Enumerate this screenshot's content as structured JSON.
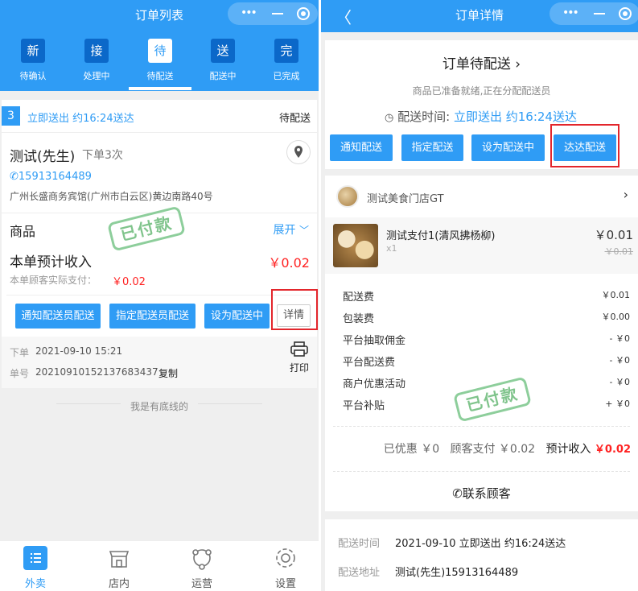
{
  "left": {
    "nav_title": "订单列表",
    "tabs": [
      {
        "icon": "新",
        "label": "待确认"
      },
      {
        "icon": "接",
        "label": "处理中"
      },
      {
        "icon": "待",
        "label": "待配送"
      },
      {
        "icon": "送",
        "label": "配送中"
      },
      {
        "icon": "完",
        "label": "已完成"
      }
    ],
    "order": {
      "index": "3",
      "delivery": "立即送出 约16:24送达",
      "status": "待配送",
      "customer": "测试(先生)",
      "order_count": "下单3次",
      "phone": "15913164489",
      "address": "广州长盛商务宾馆(广州市白云区)黄边南路40号",
      "goods_label": "商品",
      "expand_label": "展开",
      "income_label": "本单预计收入",
      "income_value": "￥0.02",
      "paid_label": "本单顾客实际支付：",
      "paid_value": "￥0.02",
      "stamp": "已付款",
      "buttons": [
        "通知配送员配送",
        "指定配送员配送",
        "设为配送中"
      ],
      "detail_button": "详情",
      "order_time_label": "下单",
      "order_time": "2021-09-10 15:21",
      "order_no_label": "单号",
      "order_no": "20210910152137683437",
      "copy_label": "复制",
      "print_label": "打印"
    },
    "bottom_line": "我是有底线的",
    "bottom_nav": [
      "外卖",
      "店内",
      "运营",
      "设置"
    ],
    "bottom_icons": [
      "list-icon",
      "store-icon",
      "operation-icon",
      "gear-icon"
    ]
  },
  "right": {
    "nav_title": "订单详情",
    "status_title": "订单待配送",
    "status_desc": "商品已准备就绪,正在分配配送员",
    "delivery_time_label": "配送时间:",
    "delivery_time_value": "立即送出 约16:24送达",
    "buttons": [
      "通知配送",
      "指定配送",
      "设为配送中",
      "达达配送"
    ],
    "store_name": "测试美食门店GT",
    "product": {
      "name": "测试支付1(清风拂杨柳)",
      "qty": "x1",
      "price": "￥0.01",
      "original_price": "￥0.01"
    },
    "fees": [
      {
        "label": "配送费",
        "value": "￥0.01"
      },
      {
        "label": "包装费",
        "value": "￥0.00"
      },
      {
        "label": "平台抽取佣金",
        "value": "- ￥0"
      },
      {
        "label": "平台配送费",
        "value": "- ￥0"
      },
      {
        "label": "商户优惠活动",
        "value": "- ￥0"
      },
      {
        "label": "平台补贴",
        "value": "+ ￥0"
      }
    ],
    "stamp": "已付款",
    "summary": {
      "discount": "已优惠 ￥0",
      "paid": "顾客支付 ￥0.02",
      "income_label": "预计收入",
      "income_value": "￥0.02"
    },
    "contact_label": "联系顾客",
    "info": [
      {
        "label": "配送时间",
        "value": "2021-09-10 立即送出 约16:24送达"
      },
      {
        "label": "配送地址",
        "value": "测试(先生)15913164489"
      }
    ]
  },
  "colors": {
    "primary": "#2f9cf5",
    "dark_blue": "#0b68c9",
    "price_red": "#f22",
    "highlight_red": "#e3262c",
    "stamp_green": "#6aba78"
  }
}
